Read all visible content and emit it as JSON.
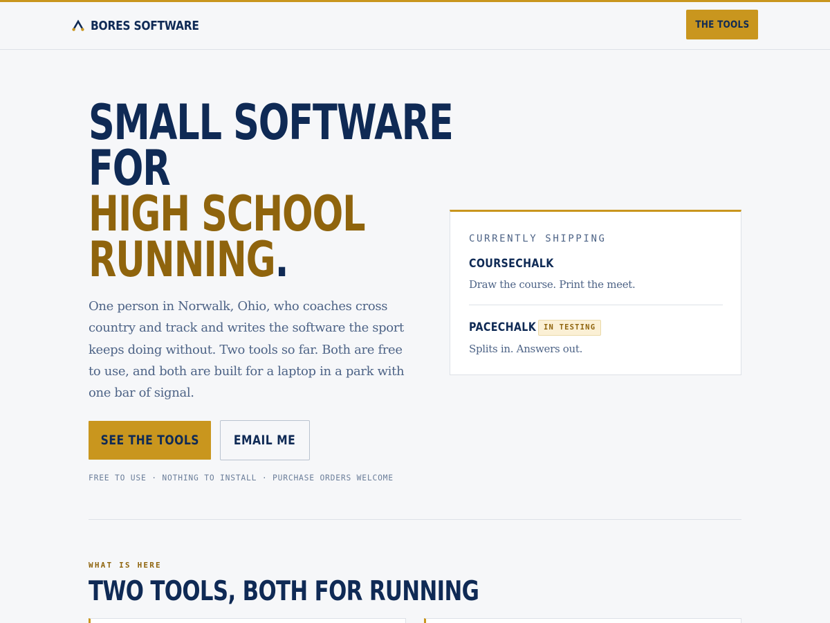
{
  "header": {
    "brand_name": "BORES SOFTWARE",
    "nav_button_label": "THE TOOLS"
  },
  "hero": {
    "title_line_1": "SMALL SOFTWARE",
    "title_line_2": "FOR",
    "title_line_3": "HIGH SCHOOL",
    "title_line_4": "RUNNING",
    "title_period": ".",
    "lede": "One person in Norwalk, Ohio, who coaches cross country and track and writes the software the sport keeps doing without. Two tools so far. Both are free to use, and both are built for a laptop in a park with one bar of signal.",
    "primary_button_label": "SEE THE TOOLS",
    "secondary_button_label": "EMAIL ME",
    "fine_print": "FREE TO USE · NOTHING TO INSTALL · PURCHASE ORDERS WELCOME"
  },
  "shipping_card": {
    "kicker": "CURRENTLY SHIPPING",
    "tools": [
      {
        "name": "COURSECHALK",
        "description": "Draw the course. Print the meet.",
        "badge": ""
      },
      {
        "name": "PACECHALK",
        "description": "Splits in. Answers out.",
        "badge": "IN TESTING"
      }
    ]
  },
  "tools_section": {
    "kicker": "WHAT IS HERE",
    "title": "TWO TOOLS, BOTH FOR RUNNING"
  },
  "colors": {
    "accent_gold": "#c9961e",
    "dark_gold_text": "#8f640d",
    "navy": "#0f2a55",
    "background": "#f6f7f9"
  },
  "icons": {
    "brand": "chevron-logo-icon"
  }
}
